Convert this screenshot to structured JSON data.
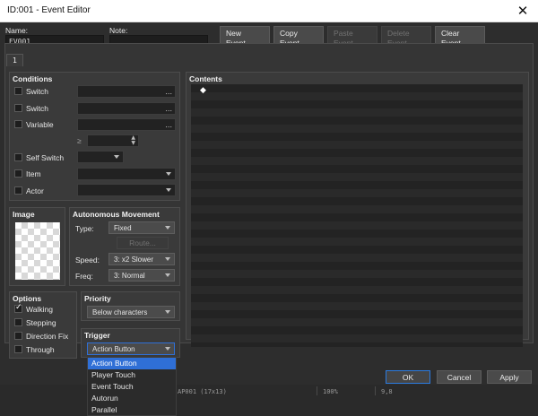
{
  "window": {
    "title": "ID:001 - Event Editor",
    "close_glyph": "✕"
  },
  "header": {
    "name_label": "Name:",
    "name_value": "EV001",
    "note_label": "Note:",
    "note_value": "",
    "buttons": {
      "new": [
        "New",
        "Event Page"
      ],
      "copy": [
        "Copy",
        "Event Page"
      ],
      "paste": [
        "Paste",
        "Event Page"
      ],
      "delete": [
        "Delete",
        "Event Page"
      ],
      "clear": [
        "Clear",
        "Event Page"
      ]
    }
  },
  "tabs": [
    "1"
  ],
  "conditions": {
    "title": "Conditions",
    "switch1": "Switch",
    "switch2": "Switch",
    "variable": "Variable",
    "ge": "≥",
    "self_switch": "Self Switch",
    "item": "Item",
    "actor": "Actor",
    "ellipsis": "..."
  },
  "image": {
    "title": "Image"
  },
  "autonomous": {
    "title": "Autonomous Movement",
    "type_label": "Type:",
    "type_value": "Fixed",
    "route_label": "Route...",
    "speed_label": "Speed:",
    "speed_value": "3: x2 Slower",
    "freq_label": "Freq:",
    "freq_value": "3: Normal"
  },
  "options": {
    "title": "Options",
    "walking": "Walking",
    "stepping": "Stepping",
    "direction_fix": "Direction Fix",
    "through": "Through",
    "walking_checked": true,
    "stepping_checked": false,
    "direction_fix_checked": false,
    "through_checked": false
  },
  "priority": {
    "title": "Priority",
    "value": "Below characters"
  },
  "trigger": {
    "title": "Trigger",
    "value": "Action Button",
    "options": [
      "Action Button",
      "Player Touch",
      "Event Touch",
      "Autorun",
      "Parallel"
    ]
  },
  "contents": {
    "title": "Contents",
    "first_line_marker": "◆"
  },
  "footer": {
    "ok": "OK",
    "cancel": "Cancel",
    "apply": "Apply"
  },
  "status": {
    "map": "AP001 (17x13)",
    "zoom": "100%",
    "coords": "9,8"
  },
  "colors": {
    "accent": "#2f6fd6",
    "ok_border": "#2b7be0"
  }
}
